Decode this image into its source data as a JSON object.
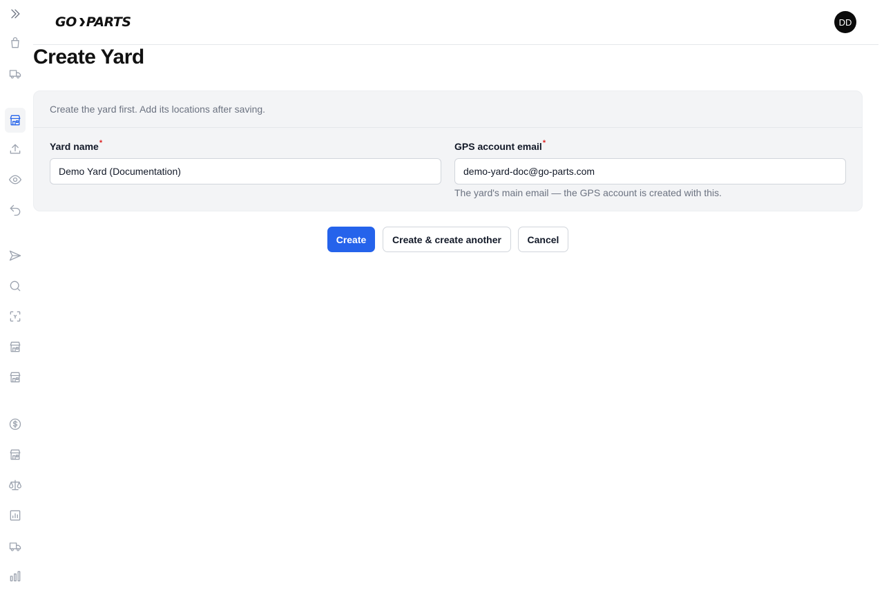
{
  "app": {
    "logo_text_left": "GO",
    "logo_text_right": "PARTS"
  },
  "user": {
    "initials": "DD"
  },
  "sidebar": {
    "items": [
      {
        "icon": "chevrons-right-icon"
      },
      {
        "icon": "shopping-bag-icon"
      },
      {
        "icon": "truck-icon"
      },
      {
        "icon": "store-icon",
        "active": true
      },
      {
        "icon": "upload-icon"
      },
      {
        "icon": "eye-icon"
      },
      {
        "icon": "undo-icon"
      },
      {
        "icon": "send-icon"
      },
      {
        "icon": "search-icon"
      },
      {
        "icon": "scan-icon"
      },
      {
        "icon": "store-icon"
      },
      {
        "icon": "store-icon"
      },
      {
        "icon": "dollar-circle-icon"
      },
      {
        "icon": "store-icon"
      },
      {
        "icon": "scale-icon"
      },
      {
        "icon": "chart-box-icon"
      },
      {
        "icon": "truck-icon"
      },
      {
        "icon": "bar-chart-icon"
      }
    ]
  },
  "page": {
    "title": "Create Yard"
  },
  "form": {
    "description": "Create the yard first. Add its locations after saving.",
    "yard_name": {
      "label": "Yard name",
      "required_mark": "*",
      "value": "Demo Yard (Documentation)"
    },
    "gps_email": {
      "label": "GPS account email",
      "required_mark": "*",
      "value": "demo-yard-doc@go-parts.com",
      "help": "The yard's main email — the GPS account is created with this."
    }
  },
  "actions": {
    "create": "Create",
    "create_another": "Create & create another",
    "cancel": "Cancel"
  },
  "colors": {
    "primary": "#2563eb",
    "required": "#dc2626"
  }
}
